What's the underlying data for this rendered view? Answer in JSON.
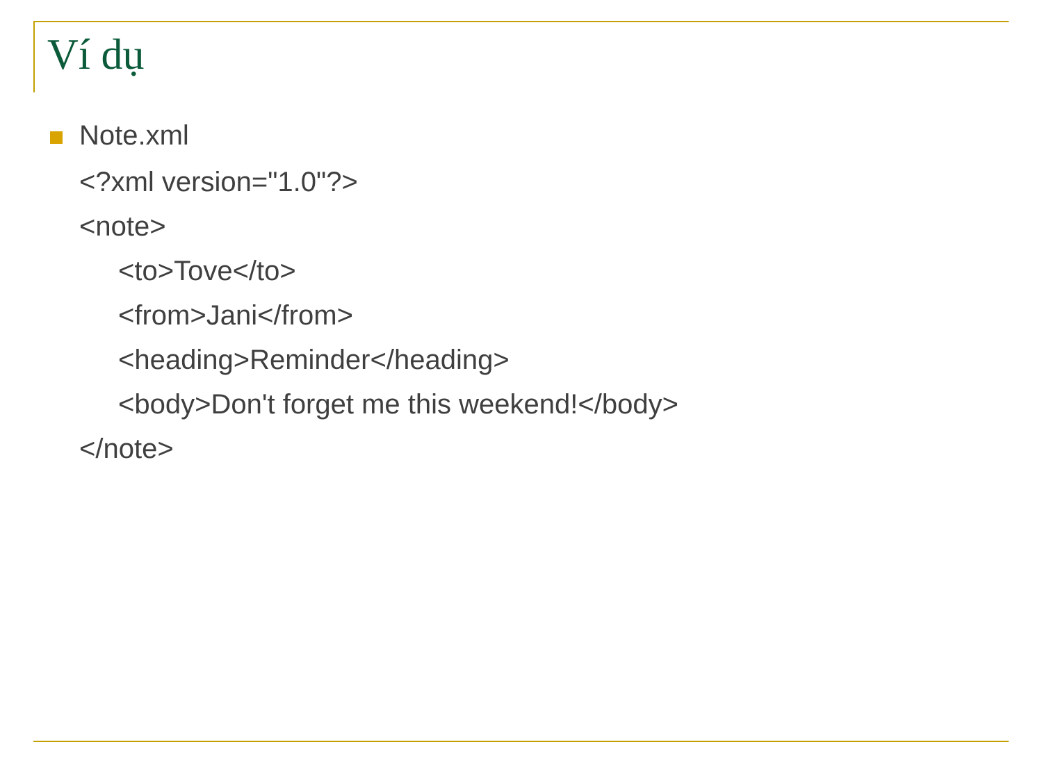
{
  "slide": {
    "title": "Ví dụ",
    "bullet": {
      "label": "Note.xml"
    },
    "code": {
      "line1": "<?xml version=\"1.0\"?>",
      "line2": "<note>",
      "line3": "<to>Tove</to>",
      "line4": "<from>Jani</from>",
      "line5": "<heading>Reminder</heading>",
      "line6": "<body>Don't forget me this weekend!</body>",
      "line7": "</note>"
    }
  }
}
